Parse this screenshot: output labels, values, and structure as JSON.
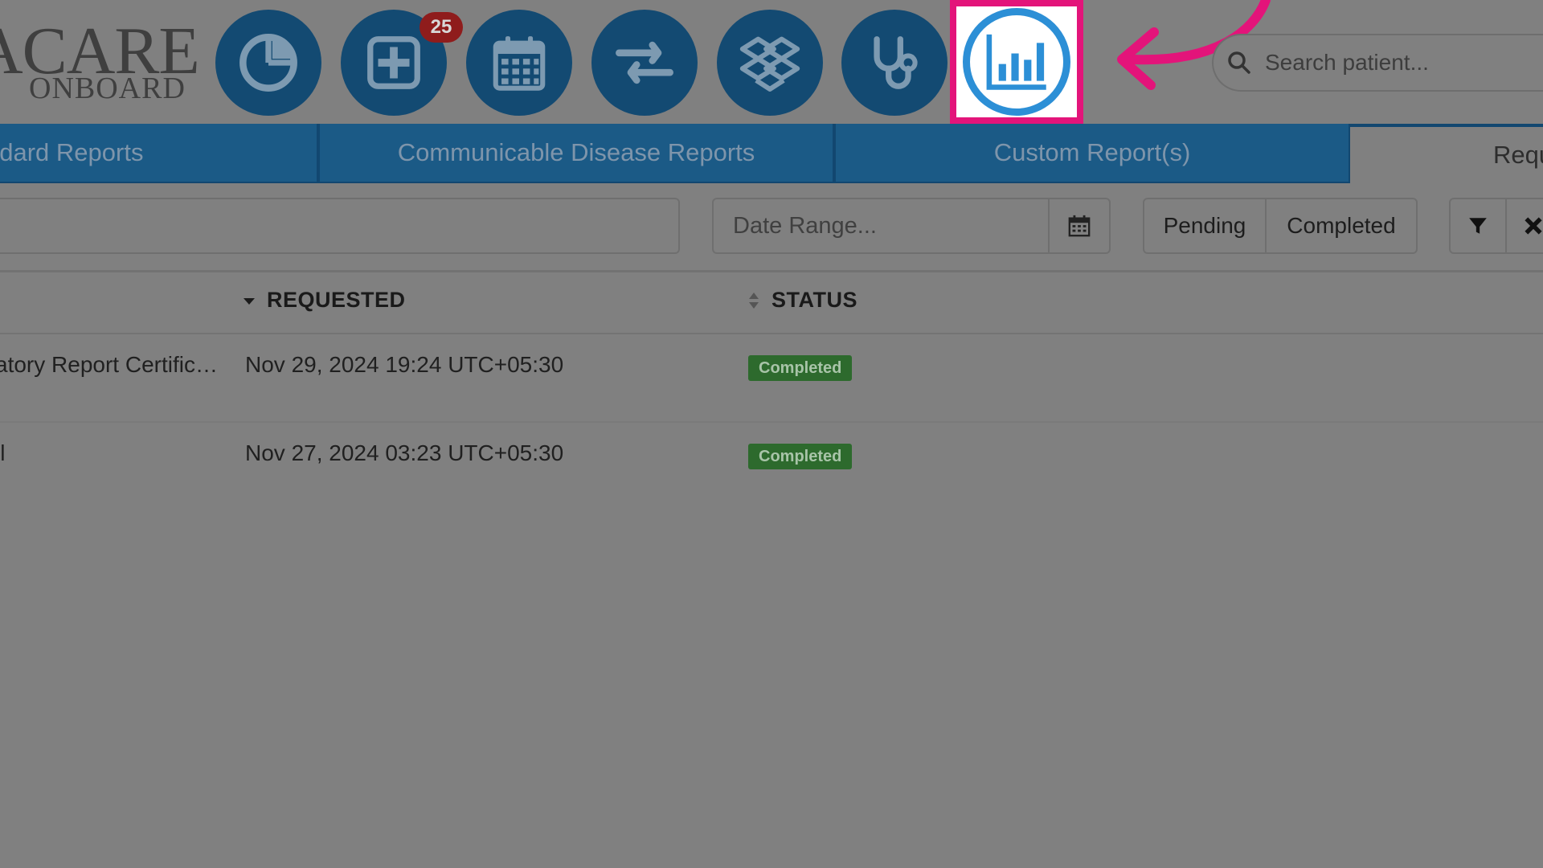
{
  "logo": {
    "main": "ACARE",
    "sub": "ONBOARD"
  },
  "toolbar": {
    "buttons": [
      {
        "icon": "pie-chart-icon"
      },
      {
        "icon": "plus-square-icon",
        "badge": "25"
      },
      {
        "icon": "calendar-icon"
      },
      {
        "icon": "exchange-arrows-icon"
      },
      {
        "icon": "dropbox-icon"
      },
      {
        "icon": "stethoscope-icon"
      },
      {
        "icon": "bar-chart-icon",
        "highlighted": true
      }
    ]
  },
  "search": {
    "placeholder": "Search patient..."
  },
  "tabs": [
    {
      "label": "ndard Reports"
    },
    {
      "label": "Communicable Disease Reports"
    },
    {
      "label": "Custom Report(s)"
    },
    {
      "label": "Requ",
      "active": true
    }
  ],
  "filters": {
    "date_range_placeholder": "Date Range...",
    "status_options": [
      "Pending",
      "Completed"
    ]
  },
  "table": {
    "columns": [
      "REQUESTED",
      "STATUS"
    ],
    "rows": [
      {
        "name": "atory Report Certific…",
        "requested": "Nov 29, 2024 19:24 UTC+05:30",
        "status": "Completed"
      },
      {
        "name": "il",
        "requested": "Nov 27, 2024 03:23 UTC+05:30",
        "status": "Completed"
      }
    ]
  },
  "colors": {
    "primary": "#124770",
    "highlight": "#e3147a",
    "icon_active": "#2c8fd6",
    "success": "#2d6a2d",
    "badge": "#8f1c1c",
    "overlay": "#808080"
  }
}
